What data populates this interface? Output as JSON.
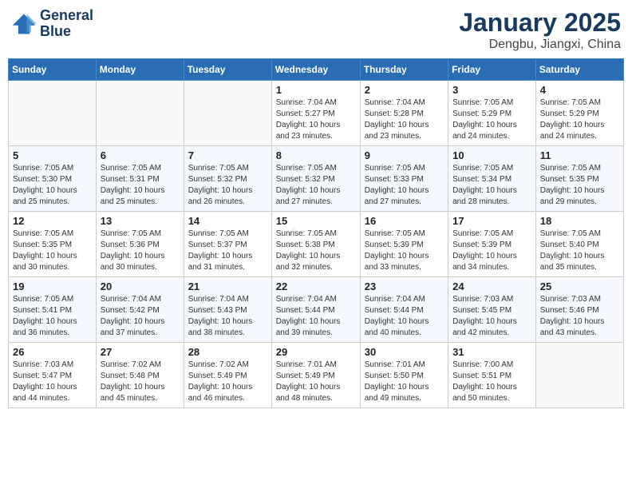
{
  "header": {
    "logo_line1": "General",
    "logo_line2": "Blue",
    "main_title": "January 2025",
    "subtitle": "Dengbu, Jiangxi, China"
  },
  "days_of_week": [
    "Sunday",
    "Monday",
    "Tuesday",
    "Wednesday",
    "Thursday",
    "Friday",
    "Saturday"
  ],
  "weeks": [
    [
      {
        "day": "",
        "info": ""
      },
      {
        "day": "",
        "info": ""
      },
      {
        "day": "",
        "info": ""
      },
      {
        "day": "1",
        "info": "Sunrise: 7:04 AM\nSunset: 5:27 PM\nDaylight: 10 hours\nand 23 minutes."
      },
      {
        "day": "2",
        "info": "Sunrise: 7:04 AM\nSunset: 5:28 PM\nDaylight: 10 hours\nand 23 minutes."
      },
      {
        "day": "3",
        "info": "Sunrise: 7:05 AM\nSunset: 5:29 PM\nDaylight: 10 hours\nand 24 minutes."
      },
      {
        "day": "4",
        "info": "Sunrise: 7:05 AM\nSunset: 5:29 PM\nDaylight: 10 hours\nand 24 minutes."
      }
    ],
    [
      {
        "day": "5",
        "info": "Sunrise: 7:05 AM\nSunset: 5:30 PM\nDaylight: 10 hours\nand 25 minutes."
      },
      {
        "day": "6",
        "info": "Sunrise: 7:05 AM\nSunset: 5:31 PM\nDaylight: 10 hours\nand 25 minutes."
      },
      {
        "day": "7",
        "info": "Sunrise: 7:05 AM\nSunset: 5:32 PM\nDaylight: 10 hours\nand 26 minutes."
      },
      {
        "day": "8",
        "info": "Sunrise: 7:05 AM\nSunset: 5:32 PM\nDaylight: 10 hours\nand 27 minutes."
      },
      {
        "day": "9",
        "info": "Sunrise: 7:05 AM\nSunset: 5:33 PM\nDaylight: 10 hours\nand 27 minutes."
      },
      {
        "day": "10",
        "info": "Sunrise: 7:05 AM\nSunset: 5:34 PM\nDaylight: 10 hours\nand 28 minutes."
      },
      {
        "day": "11",
        "info": "Sunrise: 7:05 AM\nSunset: 5:35 PM\nDaylight: 10 hours\nand 29 minutes."
      }
    ],
    [
      {
        "day": "12",
        "info": "Sunrise: 7:05 AM\nSunset: 5:35 PM\nDaylight: 10 hours\nand 30 minutes."
      },
      {
        "day": "13",
        "info": "Sunrise: 7:05 AM\nSunset: 5:36 PM\nDaylight: 10 hours\nand 30 minutes."
      },
      {
        "day": "14",
        "info": "Sunrise: 7:05 AM\nSunset: 5:37 PM\nDaylight: 10 hours\nand 31 minutes."
      },
      {
        "day": "15",
        "info": "Sunrise: 7:05 AM\nSunset: 5:38 PM\nDaylight: 10 hours\nand 32 minutes."
      },
      {
        "day": "16",
        "info": "Sunrise: 7:05 AM\nSunset: 5:39 PM\nDaylight: 10 hours\nand 33 minutes."
      },
      {
        "day": "17",
        "info": "Sunrise: 7:05 AM\nSunset: 5:39 PM\nDaylight: 10 hours\nand 34 minutes."
      },
      {
        "day": "18",
        "info": "Sunrise: 7:05 AM\nSunset: 5:40 PM\nDaylight: 10 hours\nand 35 minutes."
      }
    ],
    [
      {
        "day": "19",
        "info": "Sunrise: 7:05 AM\nSunset: 5:41 PM\nDaylight: 10 hours\nand 36 minutes."
      },
      {
        "day": "20",
        "info": "Sunrise: 7:04 AM\nSunset: 5:42 PM\nDaylight: 10 hours\nand 37 minutes."
      },
      {
        "day": "21",
        "info": "Sunrise: 7:04 AM\nSunset: 5:43 PM\nDaylight: 10 hours\nand 38 minutes."
      },
      {
        "day": "22",
        "info": "Sunrise: 7:04 AM\nSunset: 5:44 PM\nDaylight: 10 hours\nand 39 minutes."
      },
      {
        "day": "23",
        "info": "Sunrise: 7:04 AM\nSunset: 5:44 PM\nDaylight: 10 hours\nand 40 minutes."
      },
      {
        "day": "24",
        "info": "Sunrise: 7:03 AM\nSunset: 5:45 PM\nDaylight: 10 hours\nand 42 minutes."
      },
      {
        "day": "25",
        "info": "Sunrise: 7:03 AM\nSunset: 5:46 PM\nDaylight: 10 hours\nand 43 minutes."
      }
    ],
    [
      {
        "day": "26",
        "info": "Sunrise: 7:03 AM\nSunset: 5:47 PM\nDaylight: 10 hours\nand 44 minutes."
      },
      {
        "day": "27",
        "info": "Sunrise: 7:02 AM\nSunset: 5:48 PM\nDaylight: 10 hours\nand 45 minutes."
      },
      {
        "day": "28",
        "info": "Sunrise: 7:02 AM\nSunset: 5:49 PM\nDaylight: 10 hours\nand 46 minutes."
      },
      {
        "day": "29",
        "info": "Sunrise: 7:01 AM\nSunset: 5:49 PM\nDaylight: 10 hours\nand 48 minutes."
      },
      {
        "day": "30",
        "info": "Sunrise: 7:01 AM\nSunset: 5:50 PM\nDaylight: 10 hours\nand 49 minutes."
      },
      {
        "day": "31",
        "info": "Sunrise: 7:00 AM\nSunset: 5:51 PM\nDaylight: 10 hours\nand 50 minutes."
      },
      {
        "day": "",
        "info": ""
      }
    ]
  ]
}
